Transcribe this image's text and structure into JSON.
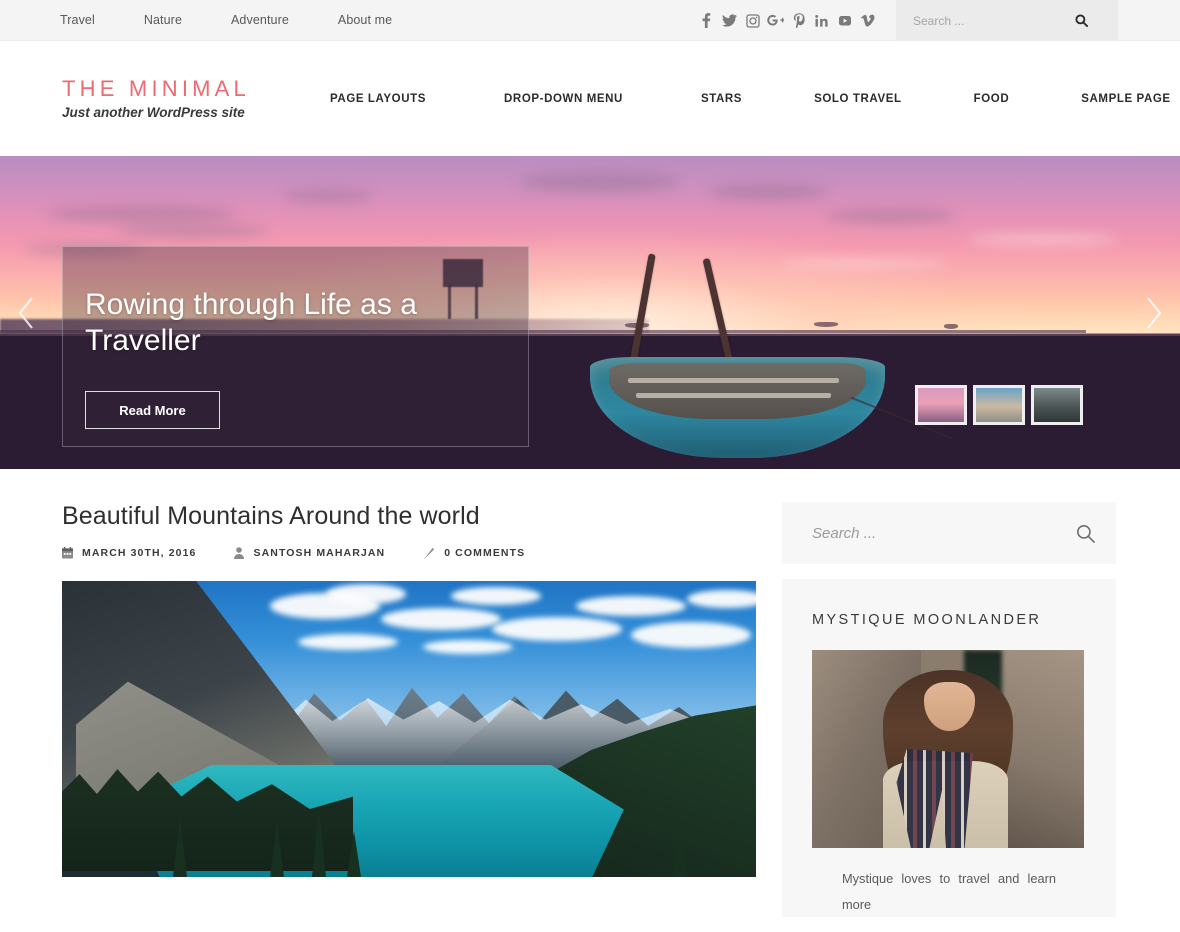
{
  "topbar": {
    "nav": [
      {
        "label": "Travel"
      },
      {
        "label": "Nature"
      },
      {
        "label": "Adventure"
      },
      {
        "label": "About me"
      }
    ],
    "social": [
      {
        "name": "facebook"
      },
      {
        "name": "twitter"
      },
      {
        "name": "instagram"
      },
      {
        "name": "google-plus"
      },
      {
        "name": "pinterest"
      },
      {
        "name": "linkedin"
      },
      {
        "name": "youtube"
      },
      {
        "name": "vimeo"
      }
    ],
    "search": {
      "placeholder": "Search ...",
      "value": "",
      "icon": "search-icon"
    }
  },
  "header": {
    "logo": "THE MINIMAL",
    "tagline": "Just another WordPress site",
    "logo_color": "#ec6a70",
    "nav": [
      {
        "label": "PAGE LAYOUTS"
      },
      {
        "label": "DROP-DOWN MENU"
      },
      {
        "label": "STARS"
      },
      {
        "label": "SOLO TRAVEL"
      },
      {
        "label": "FOOD"
      },
      {
        "label": "SAMPLE PAGE"
      }
    ]
  },
  "slider": {
    "title": "Rowing through Life as a Traveller",
    "button": "Read More",
    "prev_icon": "chevron-left-icon",
    "next_icon": "chevron-right-icon",
    "thumbnails": [
      {
        "name": "thumb-boat-sunset"
      },
      {
        "name": "thumb-beach-sunset"
      },
      {
        "name": "thumb-portrait"
      }
    ]
  },
  "post": {
    "title": "Beautiful Mountains Around the world",
    "meta": {
      "date": "MARCH 30TH, 2016",
      "date_icon": "calendar-icon",
      "author": "SANTOSH MAHARJAN",
      "author_icon": "user-icon",
      "comments": "0 COMMENTS",
      "comments_icon": "pencil-icon"
    },
    "image_alt": "mountain-lake-photo"
  },
  "sidebar": {
    "search": {
      "placeholder": "Search ...",
      "value": "",
      "icon": "search-icon"
    },
    "about": {
      "title": "MYSTIQUE MOONLANDER",
      "photo_alt": "author-portrait",
      "text": "Mystique loves to travel and learn more"
    }
  }
}
